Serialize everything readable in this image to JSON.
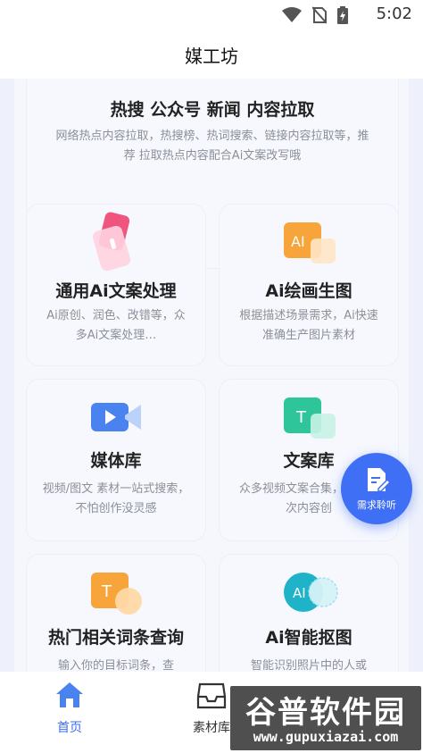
{
  "status_bar": {
    "time": "5:02"
  },
  "header": {
    "title": "媒工坊"
  },
  "cards": [
    {
      "title": "热搜 公众号 新闻 内容拉取",
      "desc": "网络热点内容拉取，热搜榜、热词搜索、链接内容拉取等，推荐 拉取热点内容配合Ai文案改写哦"
    },
    {
      "title": "通用Ai文案处理",
      "desc": "Ai原创、润色、改错等，众多Ai文案处理…"
    },
    {
      "title": "Ai绘画生图",
      "desc": "根据描述场景需求，Ai快速准确生产图片素材",
      "icon_text": "AI"
    },
    {
      "title": "媒体库",
      "desc": "视频/图文 素材一站式搜索，不怕创作没灵感"
    },
    {
      "title": "文案库",
      "desc": "众多视频文案合集，进行二次内容创",
      "icon_text": "T"
    },
    {
      "title": "热门相关词条查询",
      "desc": "输入你的目标词条，查",
      "icon_text": "T"
    },
    {
      "title": "Ai智能抠图",
      "desc": "智能识别照片中的人或",
      "icon_text": "AI"
    }
  ],
  "fab": {
    "label": "需求聆听"
  },
  "nav": {
    "tabs": [
      {
        "label": "首页"
      },
      {
        "label": "素材库"
      }
    ]
  },
  "watermark": {
    "text": "谷普软件园",
    "url": "www.gupuxiazai.com"
  },
  "colors": {
    "accent": "#3f6ff5",
    "nav_active": "#3a6df0"
  }
}
